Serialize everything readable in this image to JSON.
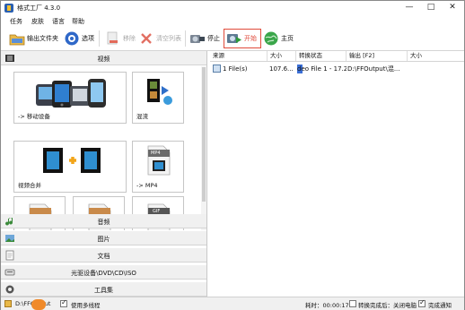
{
  "window": {
    "title": "格式工厂 4.3.0",
    "minimize_glyph": "—",
    "maximize_glyph": "□",
    "close_glyph": "✕"
  },
  "menu": [
    "任务",
    "皮肤",
    "语言",
    "帮助"
  ],
  "toolbar": {
    "output_folder": "输出文件夹",
    "options": "选项",
    "remove": "移除",
    "clear_list": "清空列表",
    "stop": "停止",
    "start": "开始",
    "home": "主页"
  },
  "left": {
    "video_header": "视频",
    "tiles": [
      {
        "caption": "-> 移动设备",
        "icon": "mobile-devices-icon"
      },
      {
        "caption": "混流",
        "icon": "mux-icon"
      },
      {
        "caption": "视频合并",
        "icon": "video-join-icon"
      },
      {
        "caption": "-> MP4",
        "icon": "mp4-icon",
        "badge": "MP4"
      },
      {
        "caption": "",
        "icon": "film-icon"
      },
      {
        "caption": "",
        "icon": "film-icon"
      },
      {
        "caption": "",
        "icon": "gif-icon",
        "badge": "GIF"
      }
    ],
    "categories": [
      "音频",
      "图片",
      "文档",
      "光驱设备\\DVD\\CD\\ISO",
      "工具集"
    ]
  },
  "table": {
    "columns": [
      "来源",
      "大小",
      "转换状态",
      "输出 [F2]",
      "大小"
    ],
    "rows": [
      {
        "source": "1 File(s)",
        "size": "107.6...",
        "status": "deo File 1 - 17.2",
        "output": "D:\\FFOutput\\混...",
        "out_size": ""
      }
    ]
  },
  "status": {
    "output_path": "D:\\FFOutput",
    "multithread": "使用多线程",
    "elapsed": "耗时：00:00:17",
    "after_convert": "转换完成后：关闭电脑",
    "notify": "完成通知"
  },
  "colors": {
    "accent": "#e04a3a",
    "header_bg": "#f0f0f0",
    "brand_blue": "#2a5fb0"
  }
}
